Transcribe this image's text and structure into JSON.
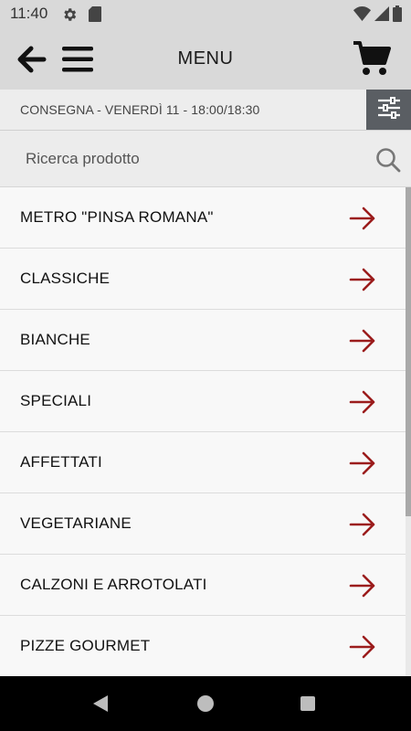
{
  "status_bar": {
    "time": "11:40",
    "icons": [
      "gear-icon",
      "sd-card-icon",
      "wifi-icon",
      "signal-icon",
      "battery-icon"
    ]
  },
  "app_bar": {
    "title": "MENU",
    "icons": [
      "back-arrow-icon",
      "hamburger-icon",
      "cart-icon"
    ]
  },
  "delivery": {
    "text": "CONSEGNA - VENERDÌ 11 - 18:00/18:30",
    "filter_icon": "sliders-icon"
  },
  "search": {
    "placeholder": "Ricerca prodotto",
    "icon": "search-icon"
  },
  "categories": [
    {
      "label": "METRO \"PINSA ROMANA\""
    },
    {
      "label": "CLASSICHE"
    },
    {
      "label": "BIANCHE"
    },
    {
      "label": "SPECIALI"
    },
    {
      "label": "AFFETTATI"
    },
    {
      "label": "VEGETARIANE"
    },
    {
      "label": "CALZONI E ARROTOLATI"
    },
    {
      "label": "PIZZE GOURMET"
    }
  ],
  "colors": {
    "accent_arrow": "#9b1c1c",
    "app_bar_bg": "#d9d9d9",
    "filter_button_bg": "#5a5e63"
  },
  "nav_bar": {
    "icons": [
      "nav-back-icon",
      "nav-home-icon",
      "nav-recent-icon"
    ]
  }
}
